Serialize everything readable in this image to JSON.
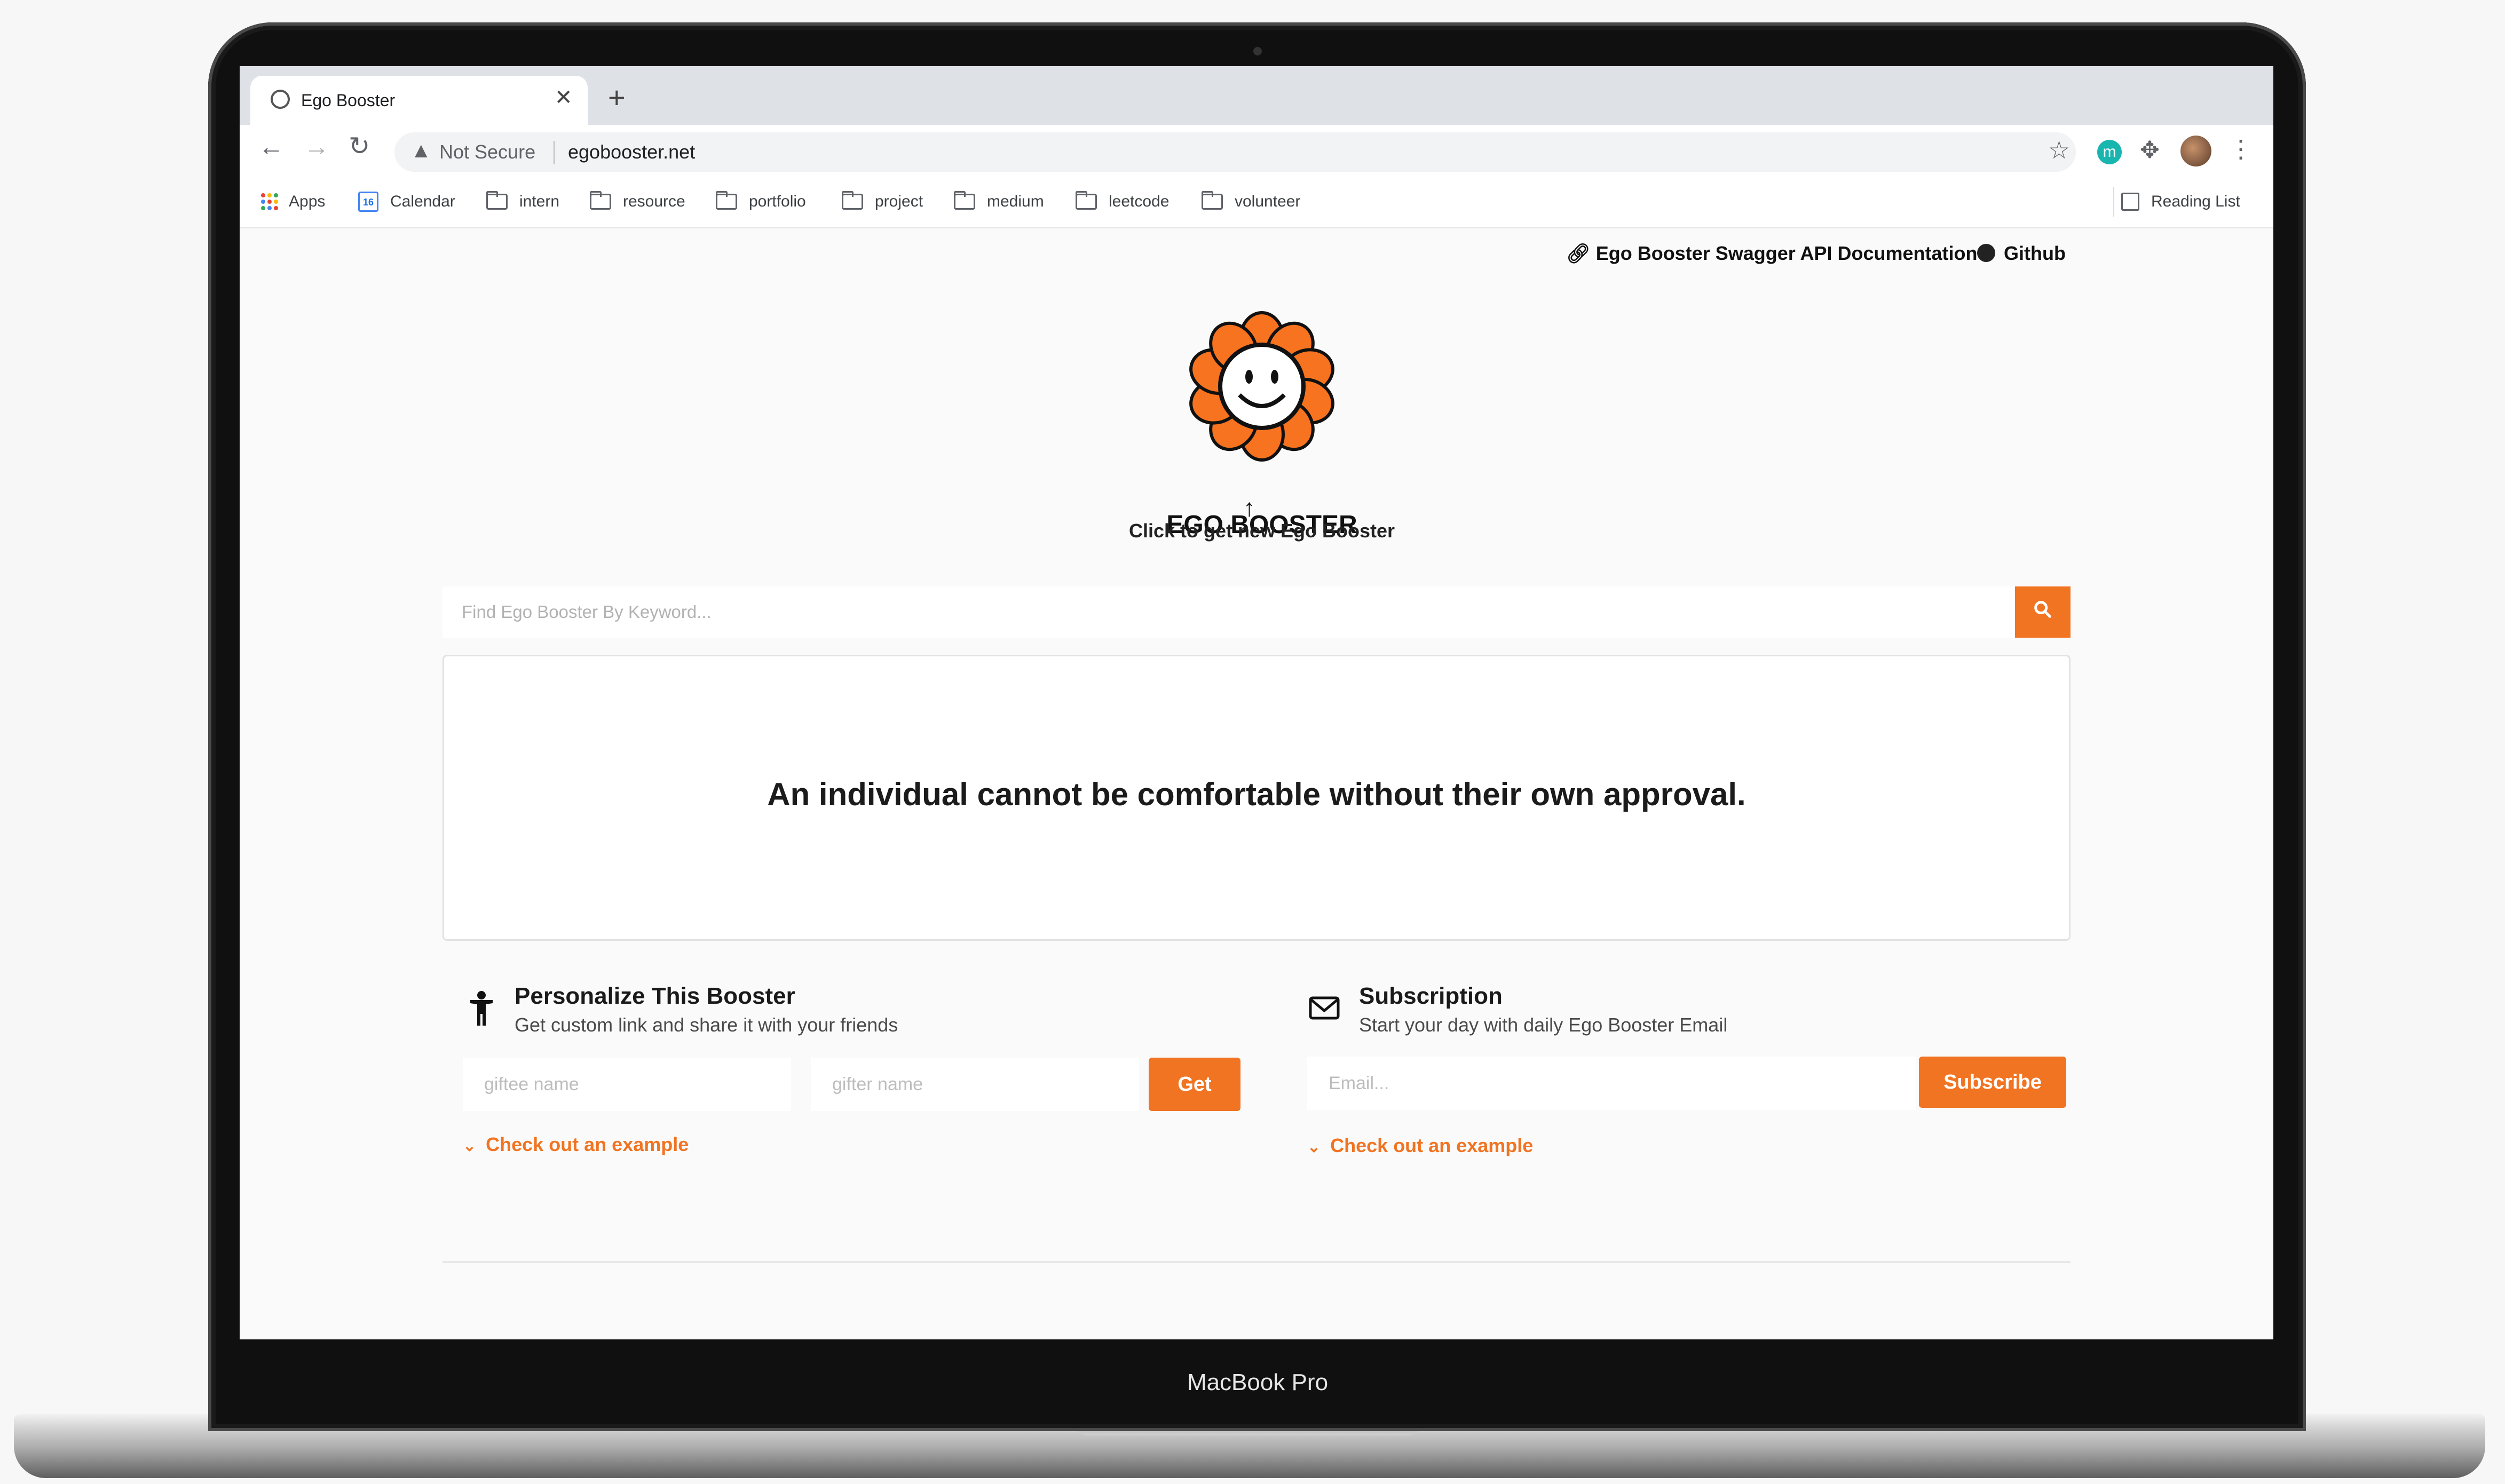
{
  "device": {
    "label": "MacBook Pro"
  },
  "browser": {
    "tab_title": "Ego Booster",
    "tab_close": "✕",
    "new_tab": "+",
    "nav": {
      "back": "←",
      "forward": "→",
      "reload": "↻"
    },
    "security_text": "Not Secure",
    "url": "egobooster.net",
    "extension_letter": "m",
    "bookmarks": [
      "Apps",
      "Calendar",
      "intern",
      "resource",
      "portfolio",
      "project",
      "medium",
      "leetcode",
      "volunteer"
    ],
    "calendar_day": "16",
    "reading_list": "Reading List"
  },
  "page": {
    "links": {
      "api_docs": "Ego Booster Swagger API Documentation",
      "github": "Github"
    },
    "logo_text": "EGO BOOSTER",
    "hint": "Click to get new Ego Booster",
    "search": {
      "placeholder": "Find Ego Booster By Keyword..."
    },
    "quote": "An individual cannot be comfortable without their own approval.",
    "personalize": {
      "title": "Personalize This Booster",
      "subtitle": "Get custom link and share it with your friends",
      "giftee_placeholder": "giftee name",
      "gifter_placeholder": "gifter name",
      "button": "Get",
      "example": "Check out an example"
    },
    "subscription": {
      "title": "Subscription",
      "subtitle": "Start your day with daily Ego Booster Email",
      "email_placeholder": "Email...",
      "button": "Subscribe",
      "example": "Check out an example"
    }
  },
  "colors": {
    "accent": "#f07422",
    "logo_orange": "#f7731f"
  },
  "icons": [
    "globe-icon",
    "warning-icon",
    "star-icon",
    "puzzle-icon",
    "link-icon",
    "github-icon",
    "search-icon",
    "person-icon",
    "mail-icon",
    "chevron-down-icon",
    "arrow-up-icon"
  ]
}
